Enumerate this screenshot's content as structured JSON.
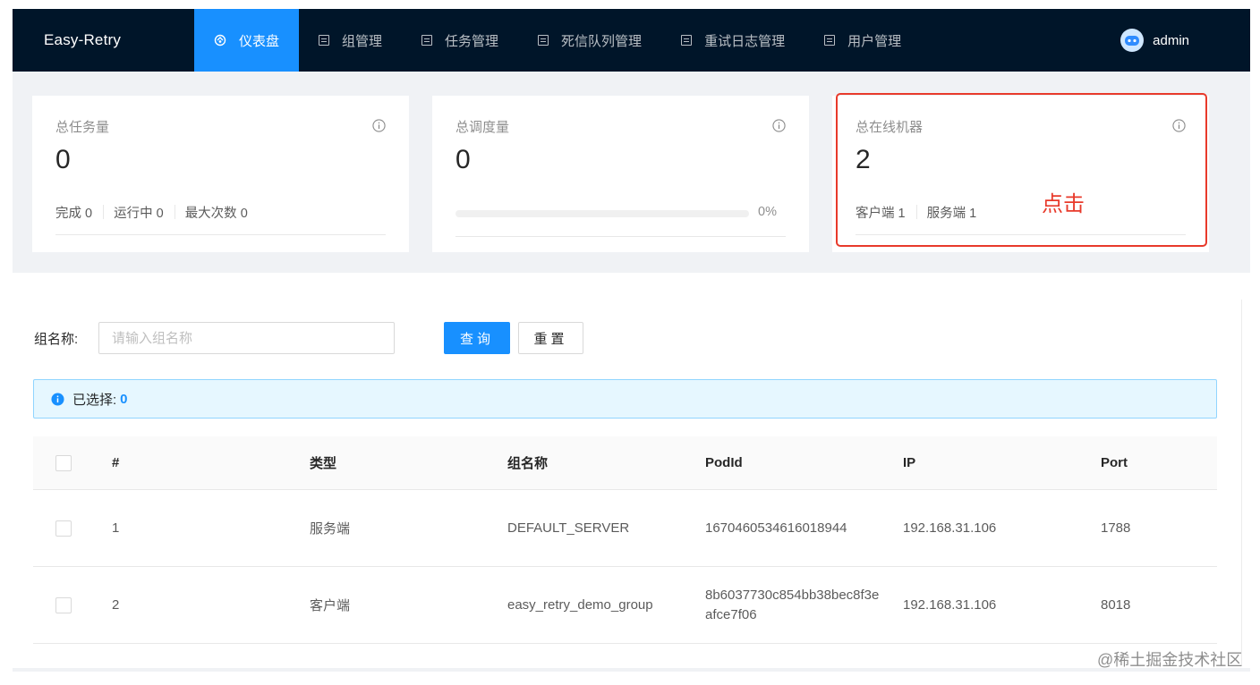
{
  "app": {
    "title": "Easy-Retry"
  },
  "nav": {
    "items": [
      {
        "label": "仪表盘",
        "active": true,
        "icon": "dashboard-icon"
      },
      {
        "label": "组管理",
        "active": false,
        "icon": "list-icon"
      },
      {
        "label": "任务管理",
        "active": false,
        "icon": "list-icon"
      },
      {
        "label": "死信队列管理",
        "active": false,
        "icon": "list-icon"
      },
      {
        "label": "重试日志管理",
        "active": false,
        "icon": "list-icon"
      },
      {
        "label": "用户管理",
        "active": false,
        "icon": "list-icon"
      }
    ],
    "user": "admin"
  },
  "cards": [
    {
      "title": "总任务量",
      "value": "0",
      "footer": [
        "完成 0",
        "运行中 0",
        "最大次数 0"
      ]
    },
    {
      "title": "总调度量",
      "value": "0",
      "progress_percent": 0,
      "progress_text": "0%"
    },
    {
      "title": "总在线机器",
      "value": "2",
      "footer": [
        "客户端 1",
        "服务端 1"
      ]
    }
  ],
  "annotation": "点击",
  "search": {
    "label": "组名称:",
    "placeholder": "请输入组名称",
    "query_button": "查询",
    "reset_button": "重置"
  },
  "alert": {
    "text": "已选择:",
    "count": "0"
  },
  "table": {
    "columns": [
      "#",
      "类型",
      "组名称",
      "PodId",
      "IP",
      "Port"
    ],
    "rows": [
      {
        "idx": "1",
        "type": "服务端",
        "group": "DEFAULT_SERVER",
        "pod": "1670460534616018944",
        "ip": "192.168.31.106",
        "port": "1788"
      },
      {
        "idx": "2",
        "type": "客户端",
        "group": "easy_retry_demo_group",
        "pod": "8b6037730c854bb38bec8f3eafce7f06",
        "ip": "192.168.31.106",
        "port": "8018"
      }
    ]
  },
  "watermark": "@稀土掘金技术社区",
  "colors": {
    "primary": "#1890ff",
    "nav_bg": "#001529",
    "highlight": "#e83a2b"
  }
}
